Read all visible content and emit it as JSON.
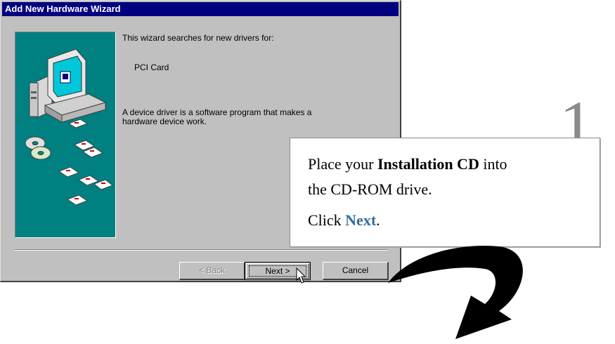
{
  "window": {
    "title": "Add New Hardware Wizard",
    "intro": "This wizard searches for new drivers for:",
    "device_name": "PCI Card",
    "description_line1": "A device driver is a software program that makes a",
    "description_line2": "hardware device work."
  },
  "buttons": {
    "back": "< Back",
    "next": "Next >",
    "cancel": "Cancel"
  },
  "callout": {
    "step_number": "1",
    "line1_prefix": "Place your ",
    "line1_bold": "Installation CD",
    "line1_suffix": " into",
    "line2": "the CD-ROM drive.",
    "line3_prefix": "Click ",
    "line3_bold": "Next",
    "line3_suffix": "."
  },
  "colors": {
    "titlebar": "#000080",
    "art_background": "#008080",
    "link_accent": "#2f6fa0"
  },
  "icons": [
    "computer-illustration",
    "cd-disc-icon",
    "floppy-disk-icon",
    "mouse-cursor-icon",
    "curved-arrow-icon"
  ]
}
